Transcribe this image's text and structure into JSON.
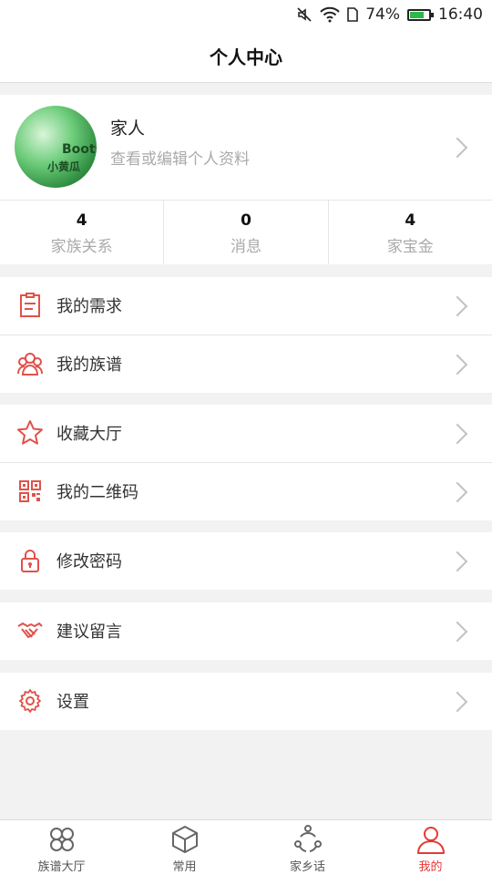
{
  "status_bar": {
    "battery": "74%",
    "time": "16:40",
    "battery_level": 0.74
  },
  "header": {
    "title": "个人中心"
  },
  "profile": {
    "name": "家人",
    "subtitle": "查看或编辑个人资料",
    "avatar_text_1": "Boots",
    "avatar_text_2": "小黄瓜"
  },
  "stats": [
    {
      "value": "4",
      "label": "家族关系"
    },
    {
      "value": "0",
      "label": "消息"
    },
    {
      "value": "4",
      "label": "家宝金"
    }
  ],
  "menu": {
    "my_needs": "我的需求",
    "my_genealogy": "我的族谱",
    "favorites_hall": "收藏大厅",
    "my_qr_code": "我的二维码",
    "change_password": "修改密码",
    "suggestions": "建议留言",
    "settings": "设置"
  },
  "tabs": [
    {
      "label": "族谱大厅",
      "icon": "clover-icon"
    },
    {
      "label": "常用",
      "icon": "box-icon"
    },
    {
      "label": "家乡话",
      "icon": "share-network-icon"
    },
    {
      "label": "我的",
      "icon": "person-icon"
    }
  ],
  "colors": {
    "accent": "#e53935",
    "icon_red": "#e0524a",
    "battery_green": "#2db84a"
  }
}
